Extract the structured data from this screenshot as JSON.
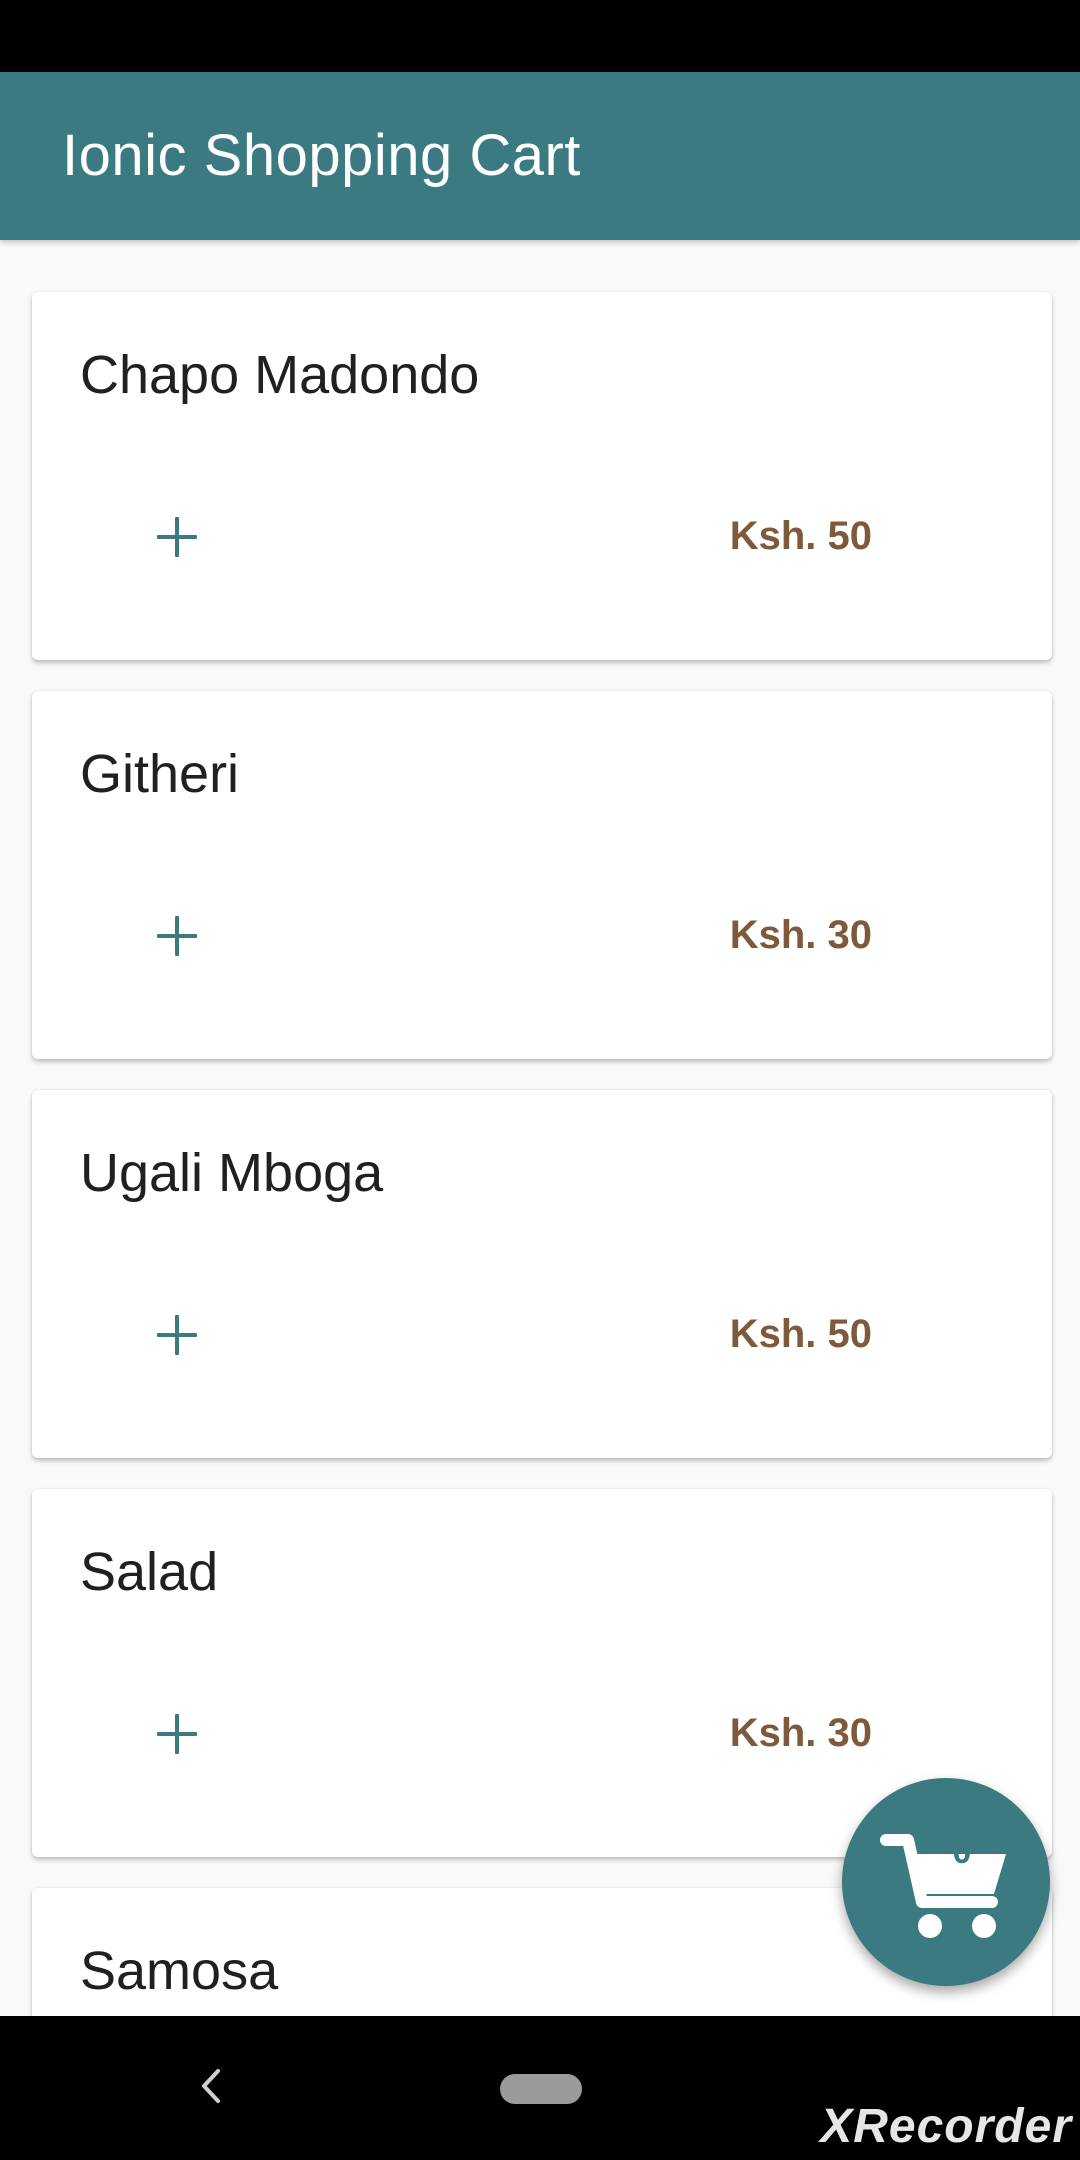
{
  "app": {
    "title": "Ionic Shopping Cart"
  },
  "products": [
    {
      "name": "Chapo Madondo",
      "price": "Ksh. 50"
    },
    {
      "name": "Githeri",
      "price": "Ksh. 30"
    },
    {
      "name": "Ugali Mboga",
      "price": "Ksh. 50"
    },
    {
      "name": "Salad",
      "price": "Ksh. 30"
    },
    {
      "name": "Samosa",
      "price": ""
    }
  ],
  "cart": {
    "count": "0",
    "icon": "cart-icon"
  },
  "icons": {
    "add": "plus-icon",
    "back": "chevron-left-icon",
    "home": "home-pill"
  },
  "watermark": "XRecorder",
  "colors": {
    "primary": "#3a7a80",
    "price": "#7d5a3c",
    "background": "#f8f9f8"
  }
}
